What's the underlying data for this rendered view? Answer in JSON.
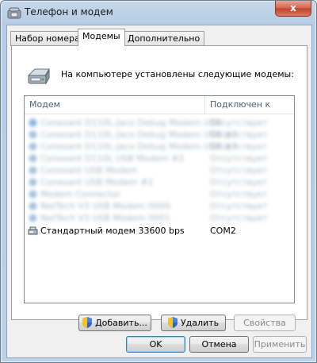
{
  "window": {
    "title": "Телефон и модем",
    "close_glyph": "x"
  },
  "tabs": [
    {
      "label": "Набор номера",
      "active": false
    },
    {
      "label": "Модемы",
      "active": true
    },
    {
      "label": "Дополнительно",
      "active": false
    }
  ],
  "panel": {
    "intro": "На компьютере установлены следующие модемы:",
    "icon": "modem-icon"
  },
  "modem_list": {
    "columns": [
      "Модем",
      "Подключен к"
    ],
    "blurred_rows": [
      {
        "name": "Conexant D110L-Jaco Debug Modem USB",
        "port": "Отсутствует"
      },
      {
        "name": "Conexant D110L-Jaco Debug Modem USB #2",
        "port": "Отсутствует"
      },
      {
        "name": "Conexant D110L-Jaco Debug Modem USB #3",
        "port": "Отсутствует"
      },
      {
        "name": "Conexant D110L USB Modem #2",
        "port": "Отсутствует"
      },
      {
        "name": "Conexant USB Modem",
        "port": "Отсутствует"
      },
      {
        "name": "Conexant USB Modem #2",
        "port": "Отсутствует"
      },
      {
        "name": "Modem Connector",
        "port": "Отсутствует"
      },
      {
        "name": "NetTech V3 USB Modem 0000",
        "port": "Отсутствует"
      },
      {
        "name": "NetTech V3 USB Modem 0001",
        "port": "Отсутствует"
      }
    ],
    "selected_row": {
      "name": "Стандартный модем 33600 bps",
      "port": "COM2"
    }
  },
  "panel_buttons": {
    "add": "Добавить...",
    "remove": "Удалить",
    "properties": "Свойства"
  },
  "dialog_buttons": {
    "ok": "OK",
    "cancel": "Отмена",
    "apply": "Применить"
  },
  "colors": {
    "frame": "#bcd2e6",
    "close": "#c1412a",
    "client": "#f0f0f0"
  }
}
